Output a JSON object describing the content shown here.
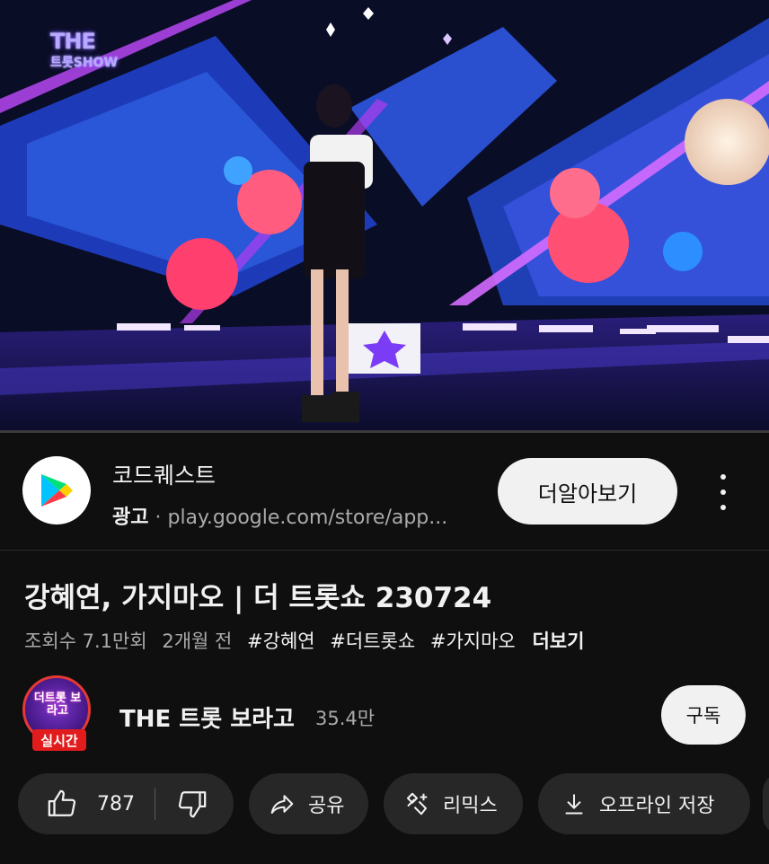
{
  "video": {
    "logo_line1": "THE",
    "logo_line2": "트롯SHOW",
    "progress_fraction": 0.0
  },
  "ad": {
    "title": "코드퀘스트",
    "label": "광고",
    "separator": "·",
    "url": "play.google.com/store/app...",
    "cta": "더알아보기",
    "icon": "google-play-icon",
    "more_icon": "more-vertical-icon"
  },
  "video_info": {
    "title": "강혜연, 가지마오 | 더 트롯쇼 230724",
    "views": "조회수 7.1만회",
    "age": "2개월 전",
    "hashtags": [
      "#강혜연",
      "#더트롯쇼",
      "#가지마오"
    ],
    "more": "더보기"
  },
  "channel": {
    "avatar_text": "더트롯 보라고",
    "live_badge": "실시간",
    "name": "THE 트롯 보라고",
    "subscribers": "35.4만",
    "subscribe_label": "구독"
  },
  "actions": {
    "like_count": "787",
    "share": "공유",
    "remix": "리믹스",
    "download": "오프라인 저장",
    "icons": [
      "like-icon",
      "dislike-icon",
      "share-icon",
      "remix-icon",
      "download-icon"
    ]
  },
  "colors": {
    "background": "#0f0f0f",
    "chip": "#272727",
    "pill_light": "#f1f1f1",
    "secondary_text": "#aaaaaa",
    "live_red": "#e21c1c"
  }
}
